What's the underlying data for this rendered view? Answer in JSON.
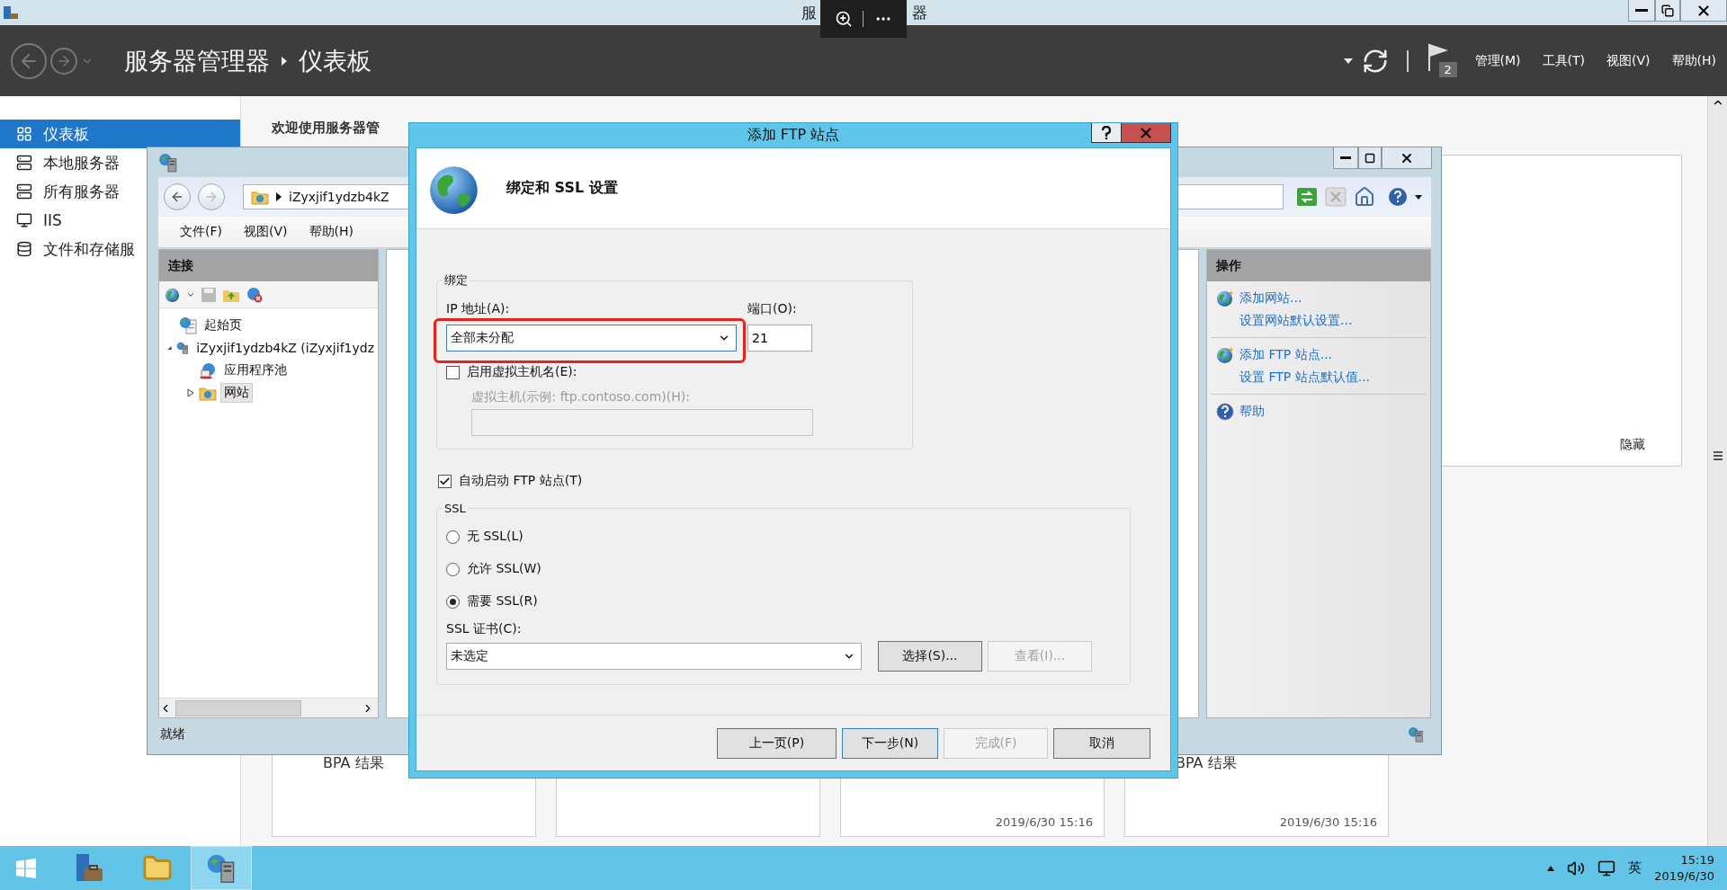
{
  "title_bar": {
    "title_parts": [
      "服",
      "器"
    ]
  },
  "header": {
    "breadcrumb": [
      "服务器管理器",
      "仪表板"
    ],
    "flag_count": "2",
    "menu": [
      "管理(M)",
      "工具(T)",
      "视图(V)",
      "帮助(H)"
    ]
  },
  "sidebar": [
    {
      "label": "仪表板",
      "kind": "dashboard",
      "selected": true
    },
    {
      "label": "本地服务器",
      "kind": "server",
      "selected": false
    },
    {
      "label": "所有服务器",
      "kind": "servers",
      "selected": false
    },
    {
      "label": "IIS",
      "kind": "iis",
      "selected": false
    },
    {
      "label": "文件和存储服",
      "kind": "storage",
      "selected": false
    }
  ],
  "welcome": "欢迎使用服务器管",
  "hide_label": "隐藏",
  "tiles": [
    {
      "kind": "status",
      "heading": "BPA 结果"
    },
    {
      "kind": "status"
    },
    {
      "kind": "status",
      "timestamp": "2019/6/30 15:16"
    },
    {
      "kind": "status",
      "heading": "BPA 结果",
      "timestamp": "2019/6/30 15:16"
    }
  ],
  "iis": {
    "address": "iZyxjif1ydzb4kZ",
    "menu": [
      "文件(F)",
      "视图(V)",
      "帮助(H)"
    ],
    "connections": {
      "title": "连接",
      "tree": [
        {
          "label": "起始页",
          "kind": "start",
          "selected": false
        },
        {
          "label": "iZyxjif1ydzb4kZ (iZyxjif1ydz",
          "kind": "server",
          "selected": false,
          "expanded": true,
          "children": [
            {
              "label": "应用程序池",
              "kind": "pool",
              "selected": false
            },
            {
              "label": "网站",
              "kind": "sites",
              "selected": true,
              "expanded": false
            }
          ]
        }
      ]
    },
    "actions": {
      "title": "操作",
      "groups": [
        {
          "kind": "site",
          "links": [
            "添加网站...",
            "设置网站默认设置..."
          ]
        },
        {
          "kind": "site",
          "links": [
            "添加 FTP 站点...",
            "设置 FTP 站点默认值..."
          ]
        },
        {
          "kind": "help",
          "links": [
            "帮助"
          ]
        }
      ]
    },
    "status": "就绪"
  },
  "dialog": {
    "title": "添加 FTP 站点",
    "heading": "绑定和 SSL 设置",
    "binding": {
      "legend": "绑定",
      "ip_label": "IP 地址(A):",
      "ip_value": "全部未分配",
      "port_label": "端口(O):",
      "port_value": "21",
      "virtual_host": {
        "label": "启用虚拟主机名(E):",
        "checked": false
      },
      "host_label": "虚拟主机(示例: ftp.contoso.com)(H):",
      "host_disabled": true
    },
    "autostart": {
      "label": "自动启动 FTP 站点(T)",
      "checked": true
    },
    "ssl": {
      "legend": "SSL",
      "options": [
        {
          "label": "无 SSL(L)",
          "selected": false
        },
        {
          "label": "允许 SSL(W)",
          "selected": false
        },
        {
          "label": "需要 SSL(R)",
          "selected": true
        }
      ],
      "cert_label": "SSL 证书(C):",
      "cert_value": "未选定",
      "buttons": [
        {
          "label": "选择(S)...",
          "disabled": false
        },
        {
          "label": "查看(I)...",
          "disabled": true
        }
      ]
    },
    "buttons": [
      {
        "label": "上一页(P)",
        "disabled": false,
        "default": false
      },
      {
        "label": "下一步(N)",
        "disabled": false,
        "default": true
      },
      {
        "label": "完成(F)",
        "disabled": true,
        "default": false
      },
      {
        "label": "取消",
        "disabled": false,
        "default": false
      }
    ]
  },
  "taskbar": {
    "apps": [
      {
        "kind": "start",
        "selected": false
      },
      {
        "kind": "server-manager",
        "selected": false
      },
      {
        "kind": "explorer",
        "selected": false
      },
      {
        "kind": "iis",
        "selected": true
      }
    ],
    "ime": "英",
    "time": "15:19",
    "date": "2019/6/30"
  }
}
